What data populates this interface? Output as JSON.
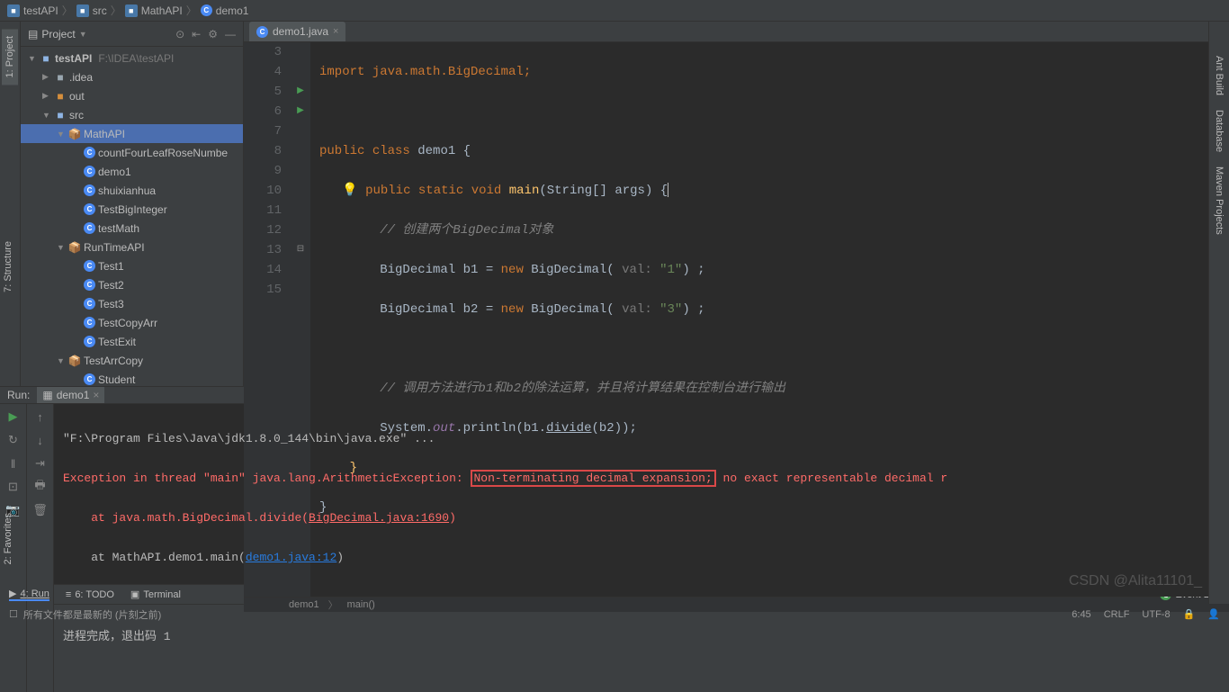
{
  "breadcrumb": {
    "items": [
      "testAPI",
      "src",
      "MathAPI",
      "demo1"
    ]
  },
  "leftTabs": {
    "project": "1: Project",
    "structure": "7: Structure",
    "favorites": "2: Favorites"
  },
  "rightTabs": {
    "ant": "Ant Build",
    "db": "Database",
    "maven": "Maven Projects"
  },
  "project": {
    "header": "Project",
    "tree": {
      "root": {
        "label": "testAPI",
        "path": "F:\\IDEA\\testAPI"
      },
      "idea": ".idea",
      "out": "out",
      "src": "src",
      "pkg1": "MathAPI",
      "files": [
        "countFourLeafRoseNumbe",
        "demo1",
        "shuixianhua",
        "TestBigInteger",
        "testMath"
      ],
      "pkg2": "RunTimeAPI",
      "files2": [
        "Test1",
        "Test2",
        "Test3",
        "TestCopyArr",
        "TestExit"
      ],
      "pkg3": "TestArrCopy",
      "files3": [
        "Student"
      ]
    }
  },
  "editor": {
    "tab": "demo1.java",
    "lines": [
      "3",
      "4",
      "5",
      "6",
      "7",
      "8",
      "9",
      "10",
      "11",
      "12",
      "13",
      "14",
      "15"
    ],
    "code": {
      "l3": "import java.math.BigDecimal;",
      "l5_public": "public",
      "l5_class": "class",
      "l5_name": "demo1",
      "l6_public": "public",
      "l6_static": "static",
      "l6_void": "void",
      "l6_main": "main",
      "l6_args": "(String[] args) {",
      "l7_cmt": "// 创建两个BigDecimal对象",
      "l8_cls": "BigDecimal",
      "l8_var": "b1 =",
      "l8_new": "new",
      "l8_ctor": "BigDecimal(",
      "l8_hint": "val:",
      "l8_val": "\"1\"",
      "l8_end": ") ;",
      "l9_cls": "BigDecimal",
      "l9_var": "b2 =",
      "l9_new": "new",
      "l9_ctor": "BigDecimal(",
      "l9_hint": "val:",
      "l9_val": "\"3\"",
      "l9_end": ") ;",
      "l11_cmt": "// 调用方法进行b1和b2的除法运算，并且将计算结果在控制台进行输出",
      "l12_sys": "System.",
      "l12_out": "out",
      "l12_print": ".println(b1.",
      "l12_div": "divide",
      "l12_end": "(b2));"
    },
    "bottom_bc": [
      "demo1",
      "main()"
    ]
  },
  "run": {
    "label": "Run:",
    "tab": "demo1",
    "console": {
      "l1": "\"F:\\Program Files\\Java\\jdk1.8.0_144\\bin\\java.exe\" ...",
      "l2a": "Exception in thread \"main\" ",
      "l2b": "java.lang.ArithmeticException",
      "l2c": ": ",
      "l2d": "Non-terminating decimal expansion;",
      "l2e": " no exact representable decimal r",
      "l3a": "    at java.math.BigDecimal.divide(",
      "l3b": "BigDecimal.java:1690",
      "l3c": ")",
      "l4a": "    at MathAPI.demo1.main(",
      "l4b": "demo1.java:12",
      "l4c": ")",
      "l6": "进程完成，退出码 1"
    }
  },
  "bottomTabs": {
    "run": "4: Run",
    "todo": "6: TODO",
    "terminal": "Terminal"
  },
  "statusBar": {
    "msg": "所有文件都是最新的 (片刻之前)",
    "pos": "6:45",
    "crlf": "CRLF",
    "enc": "UTF-8",
    "eventLog": "Event Log",
    "eventCount": "1"
  },
  "watermark": "CSDN @Alita11101_"
}
